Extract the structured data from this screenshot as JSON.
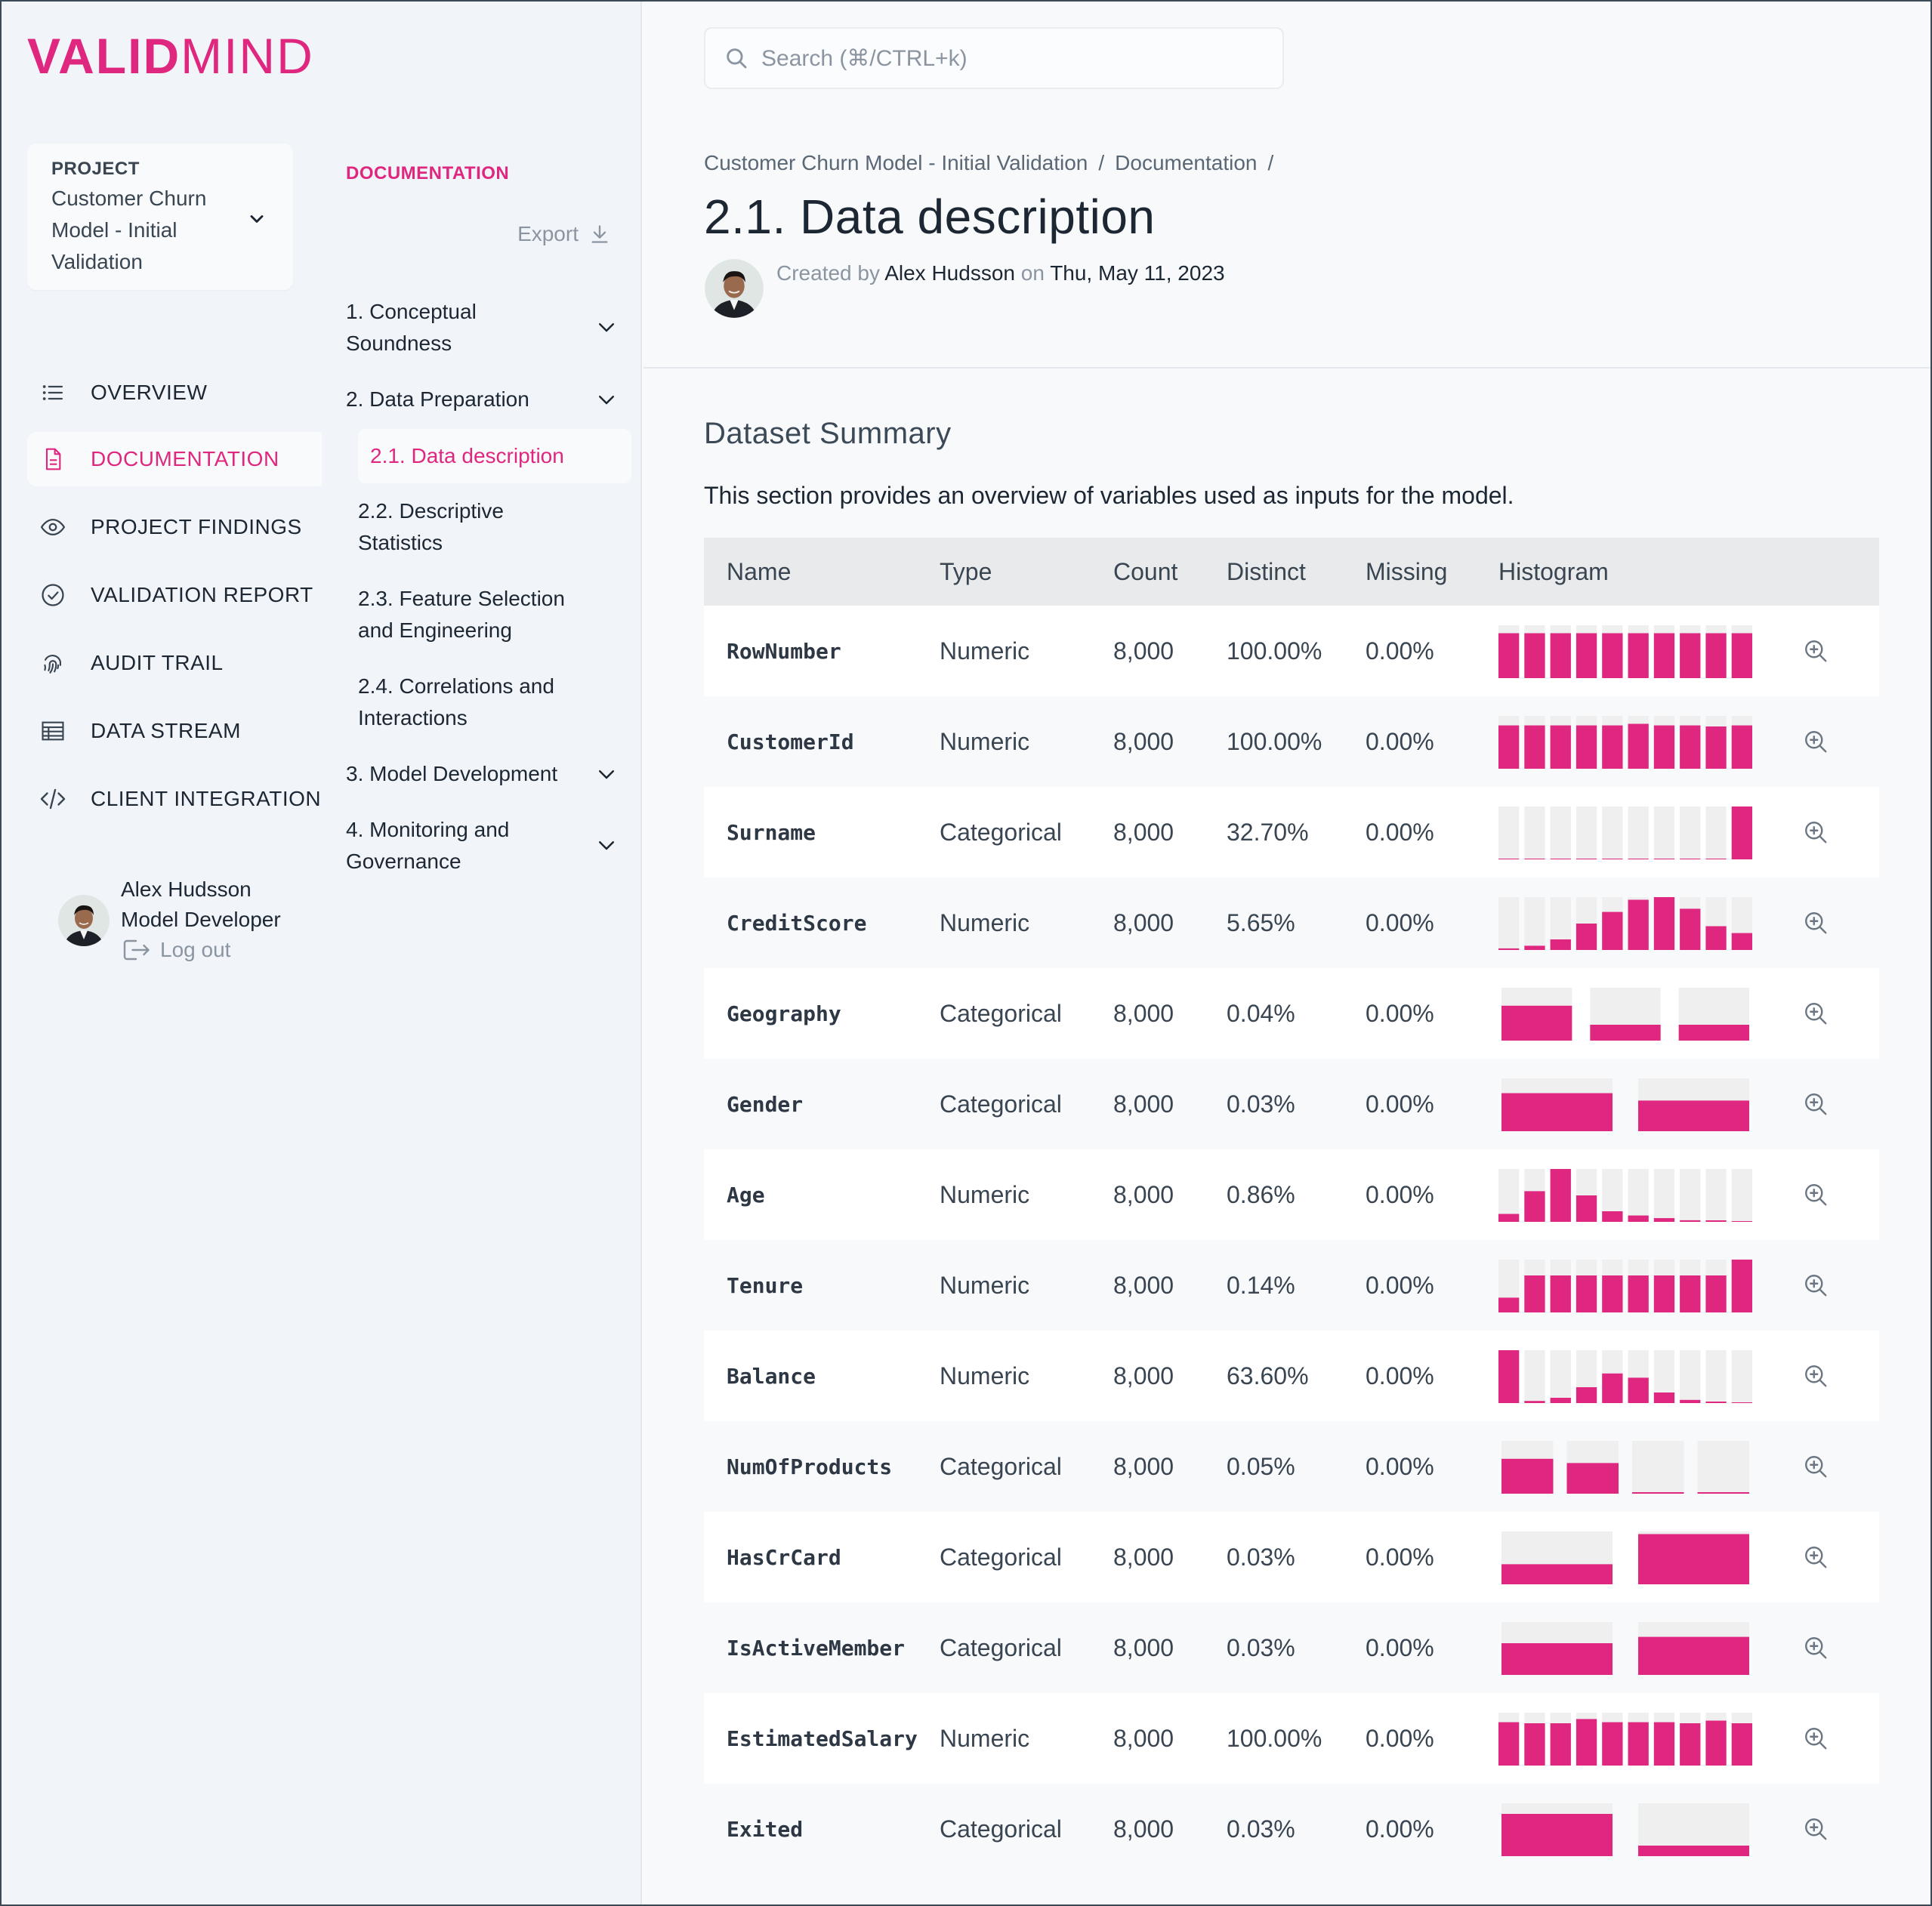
{
  "brand": {
    "logo_bold": "VALID",
    "logo_light": "MIND",
    "accent": "#df2780"
  },
  "project": {
    "label": "PROJECT",
    "name": "Customer Churn Model - Initial Validation"
  },
  "nav": [
    {
      "label": "OVERVIEW",
      "icon": "list-icon"
    },
    {
      "label": "DOCUMENTATION",
      "icon": "document-icon",
      "active": true
    },
    {
      "label": "PROJECT FINDINGS",
      "icon": "eye-icon"
    },
    {
      "label": "VALIDATION REPORT",
      "icon": "check-circle-icon"
    },
    {
      "label": "AUDIT TRAIL",
      "icon": "fingerprint-icon"
    },
    {
      "label": "DATA STREAM",
      "icon": "table-icon"
    },
    {
      "label": "CLIENT INTEGRATION",
      "icon": "code-icon"
    }
  ],
  "user": {
    "name": "Alex Hudsson",
    "role": "Model Developer",
    "logout": "Log out"
  },
  "doc_tree": {
    "heading": "DOCUMENTATION",
    "export": "Export",
    "items": [
      {
        "label": "1. Conceptual Soundness"
      },
      {
        "label": "2. Data Preparation"
      },
      {
        "label": "2.1. Data description",
        "active": true
      },
      {
        "label": "2.2. Descriptive Statistics"
      },
      {
        "label": "2.3. Feature Selection and Engineering"
      },
      {
        "label": "2.4. Correlations and Interactions"
      },
      {
        "label": "3. Model Development"
      },
      {
        "label": "4. Monitoring and Governance"
      }
    ]
  },
  "search": {
    "placeholder": "Search (⌘/CTRL+k)"
  },
  "breadcrumb": [
    "Customer Churn Model - Initial Validation",
    "Documentation"
  ],
  "page": {
    "title": "2.1. Data description",
    "created_prefix": "Created by",
    "author": "Alex Hudsson",
    "on": "on",
    "date": "Thu, May 11, 2023"
  },
  "section": {
    "title": "Dataset Summary",
    "description": "This section provides an overview of variables used as inputs for the model."
  },
  "table": {
    "headers": [
      "Name",
      "Type",
      "Count",
      "Distinct",
      "Missing",
      "Histogram"
    ],
    "rows": [
      {
        "name": "RowNumber",
        "type": "Numeric",
        "count": "8,000",
        "distinct": "100.00%",
        "missing": "0.00%",
        "hist": [
          0.85,
          0.85,
          0.85,
          0.85,
          0.85,
          0.85,
          0.85,
          0.85,
          0.85,
          0.85
        ],
        "kind": "num"
      },
      {
        "name": "CustomerId",
        "type": "Numeric",
        "count": "8,000",
        "distinct": "100.00%",
        "missing": "0.00%",
        "hist": [
          0.82,
          0.82,
          0.82,
          0.82,
          0.82,
          0.85,
          0.82,
          0.82,
          0.8,
          0.82
        ],
        "kind": "num"
      },
      {
        "name": "Surname",
        "type": "Categorical",
        "count": "8,000",
        "distinct": "32.70%",
        "missing": "0.00%",
        "hist": [
          0,
          0,
          0,
          0,
          0,
          0,
          0,
          0,
          0,
          1.0
        ],
        "kind": "num"
      },
      {
        "name": "CreditScore",
        "type": "Numeric",
        "count": "8,000",
        "distinct": "5.65%",
        "missing": "0.00%",
        "hist": [
          0.03,
          0.08,
          0.2,
          0.5,
          0.72,
          0.95,
          1.0,
          0.78,
          0.45,
          0.32
        ],
        "kind": "num"
      },
      {
        "name": "Geography",
        "type": "Categorical",
        "count": "8,000",
        "distinct": "0.04%",
        "missing": "0.00%",
        "hist": [
          0.66,
          0.3,
          0.3
        ],
        "kind": "cat"
      },
      {
        "name": "Gender",
        "type": "Categorical",
        "count": "8,000",
        "distinct": "0.03%",
        "missing": "0.00%",
        "hist": [
          0.72,
          0.58
        ],
        "kind": "cat"
      },
      {
        "name": "Age",
        "type": "Numeric",
        "count": "8,000",
        "distinct": "0.86%",
        "missing": "0.00%",
        "hist": [
          0.15,
          0.58,
          1.0,
          0.5,
          0.2,
          0.12,
          0.07,
          0.03,
          0.02,
          0.0
        ],
        "kind": "num"
      },
      {
        "name": "Tenure",
        "type": "Numeric",
        "count": "8,000",
        "distinct": "0.14%",
        "missing": "0.00%",
        "hist": [
          0.28,
          0.7,
          0.7,
          0.7,
          0.7,
          0.7,
          0.7,
          0.7,
          0.7,
          1.0
        ],
        "kind": "num"
      },
      {
        "name": "Balance",
        "type": "Numeric",
        "count": "8,000",
        "distinct": "63.60%",
        "missing": "0.00%",
        "hist": [
          1.0,
          0.04,
          0.1,
          0.3,
          0.56,
          0.48,
          0.2,
          0.06,
          0.02,
          0.0
        ],
        "kind": "num"
      },
      {
        "name": "NumOfProducts",
        "type": "Categorical",
        "count": "8,000",
        "distinct": "0.05%",
        "missing": "0.00%",
        "hist": [
          0.66,
          0.58,
          0.02,
          0.02
        ],
        "kind": "cat"
      },
      {
        "name": "HasCrCard",
        "type": "Categorical",
        "count": "8,000",
        "distinct": "0.03%",
        "missing": "0.00%",
        "hist": [
          0.38,
          0.95
        ],
        "kind": "cat"
      },
      {
        "name": "IsActiveMember",
        "type": "Categorical",
        "count": "8,000",
        "distinct": "0.03%",
        "missing": "0.00%",
        "hist": [
          0.6,
          0.72
        ],
        "kind": "cat"
      },
      {
        "name": "EstimatedSalary",
        "type": "Numeric",
        "count": "8,000",
        "distinct": "100.00%",
        "missing": "0.00%",
        "hist": [
          0.82,
          0.8,
          0.8,
          0.88,
          0.82,
          0.82,
          0.82,
          0.8,
          0.85,
          0.8
        ],
        "kind": "num"
      },
      {
        "name": "Exited",
        "type": "Categorical",
        "count": "8,000",
        "distinct": "0.03%",
        "missing": "0.00%",
        "hist": [
          0.8,
          0.2
        ],
        "kind": "cat"
      }
    ]
  }
}
